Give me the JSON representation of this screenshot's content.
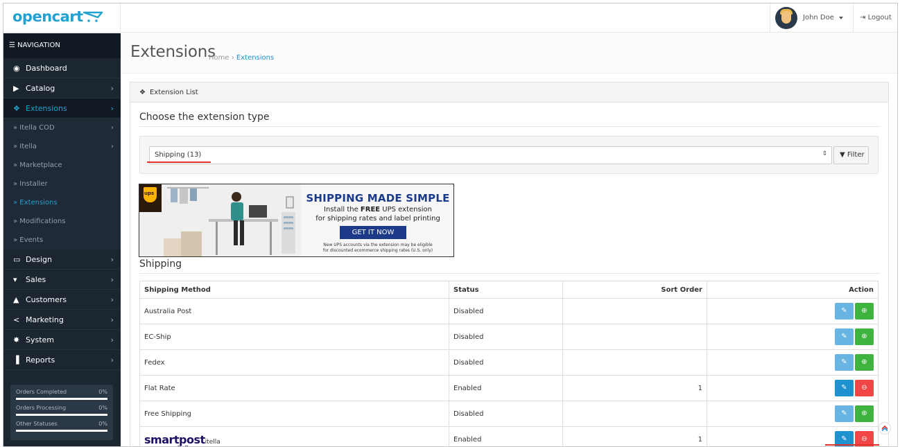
{
  "header": {
    "logo_text": "opencart",
    "user_name": "John Doe",
    "logout_label": "Logout"
  },
  "sidebar": {
    "title": "NAVIGATION",
    "items": [
      {
        "label": "Dashboard",
        "icon": "dashboard-icon",
        "glyph": "◉"
      },
      {
        "label": "Catalog",
        "icon": "tag-icon",
        "glyph": "▶"
      },
      {
        "label": "Extensions",
        "icon": "puzzle-icon",
        "glyph": "❖"
      },
      {
        "label": "Design",
        "icon": "monitor-icon",
        "glyph": "▭"
      },
      {
        "label": "Sales",
        "icon": "cart-icon",
        "glyph": "▾"
      },
      {
        "label": "Customers",
        "icon": "user-icon",
        "glyph": "▲"
      },
      {
        "label": "Marketing",
        "icon": "share-icon",
        "glyph": "<"
      },
      {
        "label": "System",
        "icon": "gear-icon",
        "glyph": "✸"
      },
      {
        "label": "Reports",
        "icon": "bar-chart-icon",
        "glyph": "▐"
      }
    ],
    "sub_items": [
      {
        "label": "» Itella COD"
      },
      {
        "label": "» Itella"
      },
      {
        "label": "» Marketplace"
      },
      {
        "label": "» Installer"
      },
      {
        "label": "» Extensions"
      },
      {
        "label": "» Modifications"
      },
      {
        "label": "» Events"
      }
    ],
    "stats": [
      {
        "label": "Orders Completed",
        "pct": "0%"
      },
      {
        "label": "Orders Processing",
        "pct": "0%"
      },
      {
        "label": "Other Statuses",
        "pct": "0%"
      }
    ]
  },
  "page": {
    "title": "Extensions",
    "breadcrumb_home": "Home",
    "breadcrumb_sep": "›",
    "breadcrumb_current": "Extensions"
  },
  "panel": {
    "heading": "Extension List",
    "choose_heading": "Choose the extension type",
    "select_value": "Shipping (13)",
    "filter_label": "Filter",
    "section_heading": "Shipping"
  },
  "banner": {
    "badge": "ups",
    "title": "SHIPPING MADE SIMPLE",
    "line1_pre": "Install the ",
    "line1_bold": "FREE",
    "line1_post": " UPS extension",
    "line2": "for shipping rates and label printing",
    "cta": "GET IT NOW",
    "fine1": "New UPS accounts via the extension may be eligible",
    "fine2": "for discounted ecommerce shipping rates (U.S. only)"
  },
  "table": {
    "headers": {
      "method": "Shipping Method",
      "status": "Status",
      "sort": "Sort Order",
      "action": "Action"
    },
    "rows": [
      {
        "name": "Australia Post",
        "status": "Disabled",
        "sort": "",
        "installed": false
      },
      {
        "name": "EC-Ship",
        "status": "Disabled",
        "sort": "",
        "installed": false
      },
      {
        "name": "Fedex",
        "status": "Disabled",
        "sort": "",
        "installed": false
      },
      {
        "name": "Flat Rate",
        "status": "Enabled",
        "sort": "1",
        "installed": true
      },
      {
        "name": "Free Shipping",
        "status": "Disabled",
        "sort": "",
        "installed": false
      },
      {
        "name": "smartpost",
        "suffix": "itella",
        "sub": "itella",
        "status": "Enabled",
        "sort": "1",
        "installed": true
      }
    ]
  },
  "colors": {
    "sidebar_bg": "#1b2631",
    "accent": "#23a1d1",
    "edit_button": "#1e91cf",
    "install_button": "#3eb43e",
    "uninstall_button": "#f24545",
    "highlight_underline": "#e0322a"
  }
}
